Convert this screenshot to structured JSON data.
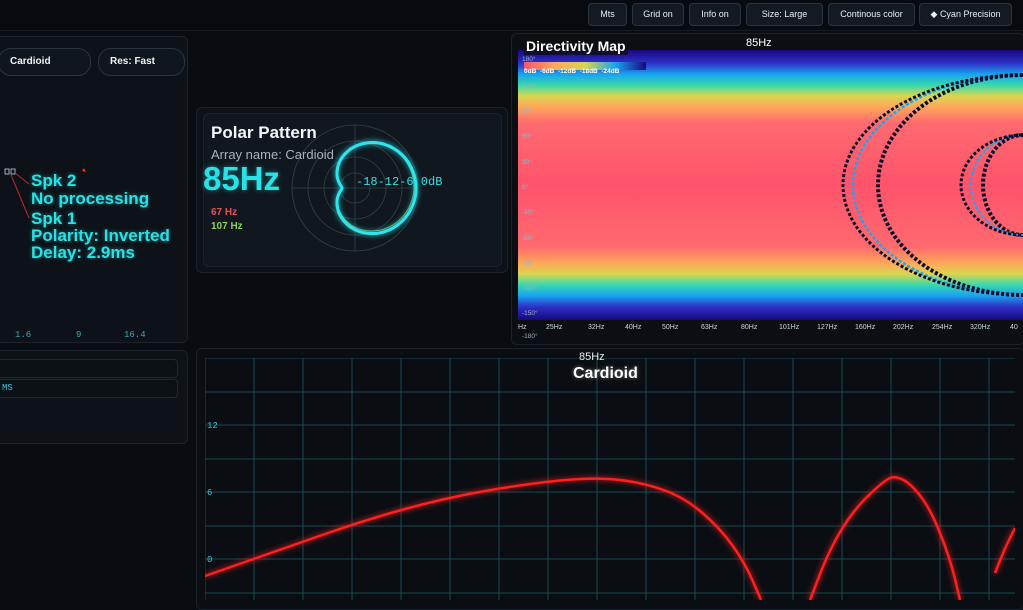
{
  "toolbar": {
    "units": "Mts",
    "grid": "Grid on",
    "info": "Info on",
    "size": "Size: Large",
    "color_mode": "Continous color",
    "theme": "◆ Cyan Precision"
  },
  "left_panel": {
    "preset": "Cardioid",
    "resolution": "Res: Fast",
    "spk2_label": "Spk 2",
    "spk2_processing": "No processing",
    "spk1_label": "Spk 1",
    "spk1_polarity": "Polarity: Inverted",
    "spk1_delay": "Delay: 2.9ms",
    "axis_ticks": [
      "1.6",
      "9",
      "16.4"
    ],
    "ms_row_text": "MS"
  },
  "polar": {
    "title": "Polar Pattern",
    "array_name": "Array name: Cardioid",
    "frequency": "85Hz",
    "freq_low": "67 Hz",
    "freq_high": "107 Hz",
    "db_scale": "-18-12-6 0dB",
    "colors": {
      "main": "#2ce6ee",
      "low": "#e2505a",
      "high": "#8fd14f"
    }
  },
  "heatmap": {
    "title": "Directivity Map",
    "frequency": "85Hz",
    "legend": [
      "0dB",
      "-6dB",
      "-12dB",
      "-18dB",
      "-24dB"
    ],
    "y_labels": [
      "180°",
      "150°",
      "120°",
      "90°",
      "60°",
      "30°",
      "0°",
      "-30°",
      "-60°",
      "-90°",
      "-120°",
      "-150°",
      "-180°"
    ],
    "x_labels": [
      "Hz",
      "25Hz",
      "32Hz",
      "40Hz",
      "50Hz",
      "63Hz",
      "80Hz",
      "101Hz",
      "127Hz",
      "160Hz",
      "202Hz",
      "254Hz",
      "320Hz",
      "40"
    ]
  },
  "response": {
    "frequency": "85Hz",
    "title": "Cardioid",
    "y_ticks": [
      "12",
      "6",
      "0"
    ],
    "line_color": "#ff1f1f"
  }
}
